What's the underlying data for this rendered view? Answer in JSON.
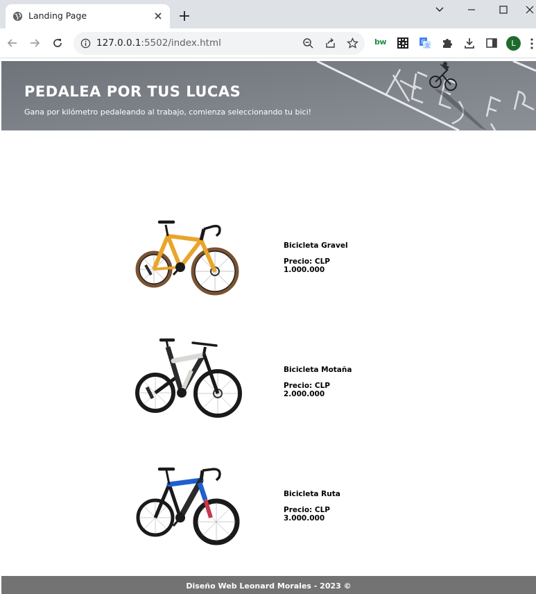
{
  "browser": {
    "tab_title": "Landing Page",
    "url_host": "127.0.0.1",
    "url_rest": ":5502/index.html",
    "extensions": [
      "bw-extension-icon",
      "qr-icon",
      "translate-icon",
      "puzzle-icon"
    ],
    "avatar_letter": "L"
  },
  "hero": {
    "title": "PEDALEA POR TUS LUCAS",
    "subtitle": "Gana por kilómetro pedaleando al trabajo, comienza seleccionando tu bici!"
  },
  "products": [
    {
      "name": "Bicicleta Gravel",
      "price_label": "Precio: CLP",
      "price": "1.000.000",
      "frame_color": "#e9a52a",
      "tire_color": "#7a5230"
    },
    {
      "name": "Bicicleta Motaña",
      "price_label": "Precio: CLP",
      "price": "2.000.000",
      "frame_color": "#d8d8d4",
      "tire_color": "#1a1a1a"
    },
    {
      "name": "Bicicleta Ruta",
      "price_label": "Precio: CLP",
      "price": "3.000.000",
      "frame_color": "#1f5fcf",
      "tire_color": "#1a1a1a"
    }
  ],
  "footer": {
    "text": "Diseño Web Leonard Morales - 2023 ©"
  }
}
